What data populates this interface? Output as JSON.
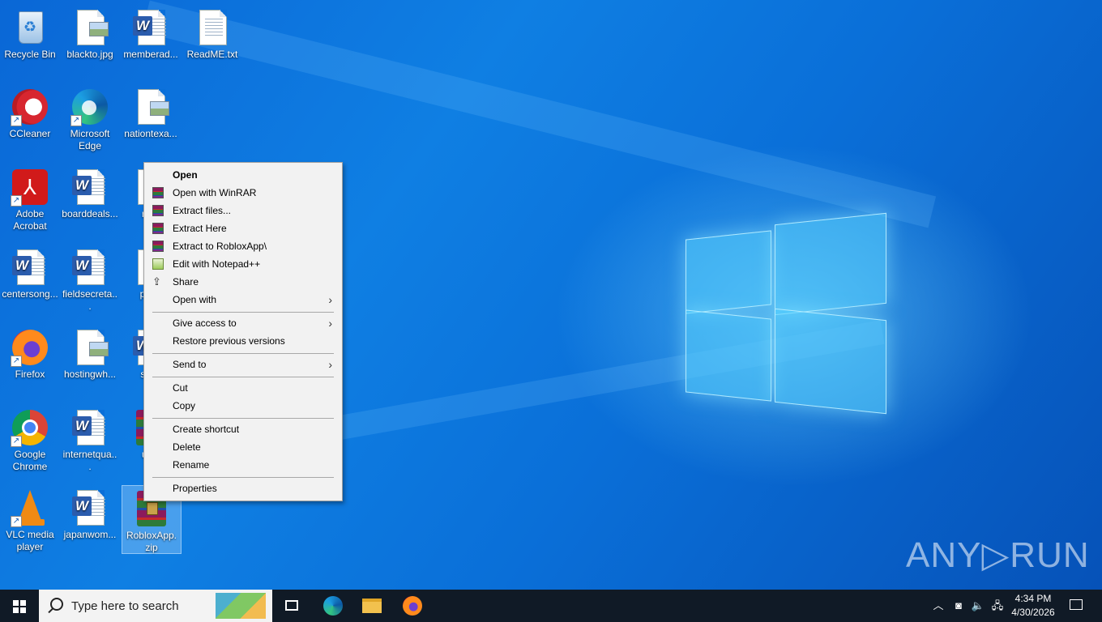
{
  "desktop": {
    "icons": [
      {
        "label": "Recycle Bin"
      },
      {
        "label": "blackto.jpg"
      },
      {
        "label": "memberad..."
      },
      {
        "label": "ReadME.txt"
      },
      {
        "label": "CCleaner"
      },
      {
        "label": "Microsoft Edge"
      },
      {
        "label": "nationtexa..."
      },
      {
        "label": "Adobe Acrobat"
      },
      {
        "label": "boarddeals..."
      },
      {
        "label": "nice"
      },
      {
        "label": "centersong..."
      },
      {
        "label": "fieldsecreta..."
      },
      {
        "label": "party"
      },
      {
        "label": "Firefox"
      },
      {
        "label": "hostingwh..."
      },
      {
        "label": "spec"
      },
      {
        "label": "Google Chrome"
      },
      {
        "label": "internetqua..."
      },
      {
        "label": "uplc"
      },
      {
        "label": "VLC media player"
      },
      {
        "label": "japanwom..."
      },
      {
        "label": "RobloxApp.zip"
      }
    ]
  },
  "context_menu": {
    "items": [
      {
        "label": "Open"
      },
      {
        "label": "Open with WinRAR"
      },
      {
        "label": "Extract files..."
      },
      {
        "label": "Extract Here"
      },
      {
        "label": "Extract to RobloxApp\\"
      },
      {
        "label": "Edit with Notepad++"
      },
      {
        "label": "Share"
      },
      {
        "label": "Open with"
      },
      {
        "label": "Give access to"
      },
      {
        "label": "Restore previous versions"
      },
      {
        "label": "Send to"
      },
      {
        "label": "Cut"
      },
      {
        "label": "Copy"
      },
      {
        "label": "Create shortcut"
      },
      {
        "label": "Delete"
      },
      {
        "label": "Rename"
      },
      {
        "label": "Properties"
      }
    ],
    "submenu_arrow": "›"
  },
  "taskbar": {
    "search_placeholder": "Type here to search",
    "time": "4:34 PM",
    "date": "4/30/2026"
  },
  "watermark": "ANY▷RUN"
}
